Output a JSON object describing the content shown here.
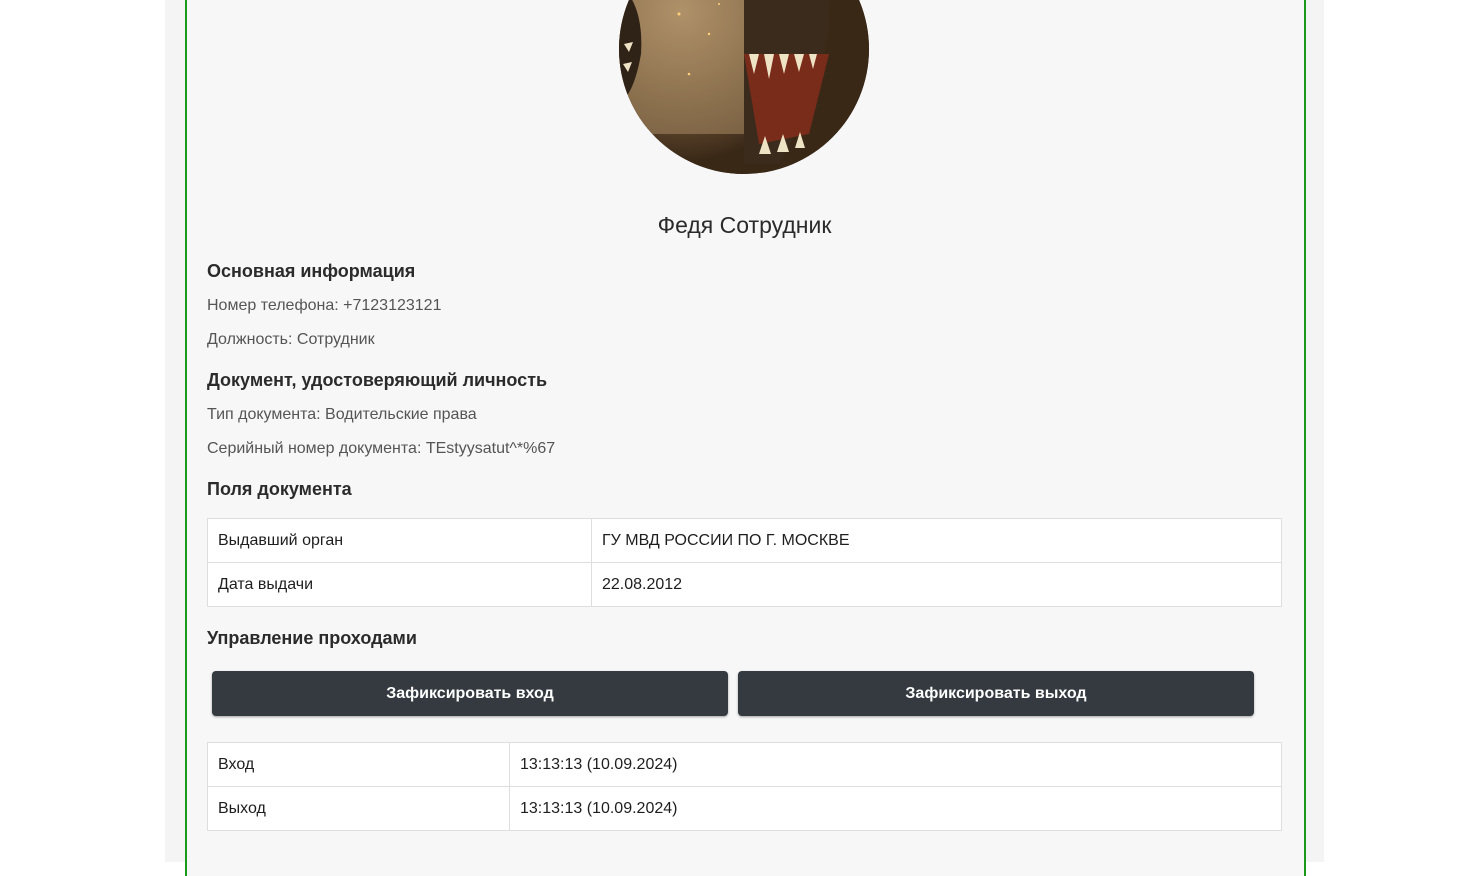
{
  "employee": {
    "name": "Федя Сотрудник"
  },
  "basic_info": {
    "title": "Основная информация",
    "phone": "Номер телефона: +7123123121",
    "position": "Должность: Сотрудник"
  },
  "id_document": {
    "title": "Документ, удостоверяющий личность",
    "type": "Тип документа: Водительские права",
    "serial": "Серийный номер документа: TEstyysatut^*%67"
  },
  "document_fields": {
    "title": "Поля документа",
    "rows": [
      {
        "label": "Выдавший орган",
        "value": "ГУ МВД РОССИИ ПО Г. МОСКВЕ"
      },
      {
        "label": "Дата выдачи",
        "value": "22.08.2012"
      }
    ]
  },
  "pass_control": {
    "title": "Управление проходами",
    "entry_button": "Зафиксировать вход",
    "exit_button": "Зафиксировать выход",
    "log": [
      {
        "label": "Вход",
        "value": "13:13:13 (10.09.2024)"
      },
      {
        "label": "Выход",
        "value": "13:13:13 (10.09.2024)"
      }
    ]
  },
  "colors": {
    "accent_border": "#1a9a1a",
    "button_bg": "#343a40",
    "button_text": "#ffffff"
  }
}
